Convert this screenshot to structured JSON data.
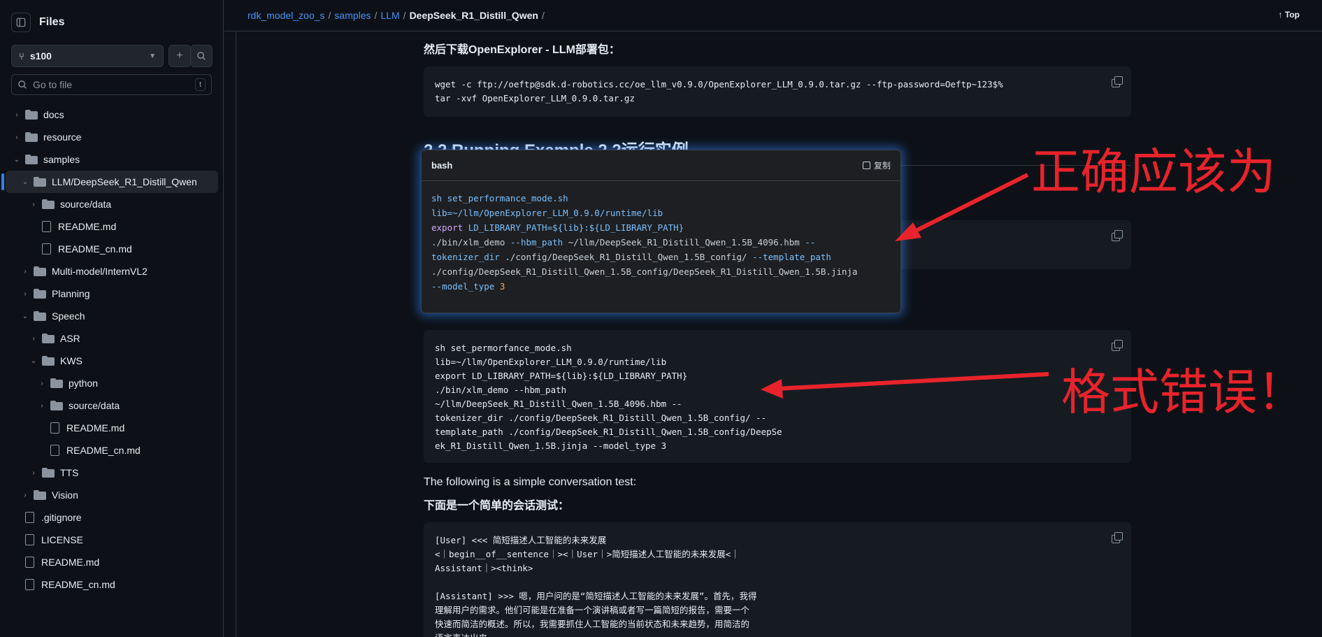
{
  "sidebar": {
    "title": "Files",
    "branch": "s100",
    "goto_placeholder": "Go to file",
    "goto_kbd": "t",
    "tree": [
      {
        "label": "docs",
        "type": "folder",
        "depth": 0,
        "expanded": false
      },
      {
        "label": "resource",
        "type": "folder",
        "depth": 0,
        "expanded": false
      },
      {
        "label": "samples",
        "type": "folder",
        "depth": 0,
        "expanded": true
      },
      {
        "label": "LLM/DeepSeek_R1_Distill_Qwen",
        "type": "folder",
        "depth": 1,
        "expanded": true,
        "selected": true
      },
      {
        "label": "source/data",
        "type": "folder",
        "depth": 2,
        "expanded": false
      },
      {
        "label": "README.md",
        "type": "file",
        "depth": 2
      },
      {
        "label": "README_cn.md",
        "type": "file",
        "depth": 2
      },
      {
        "label": "Multi-model/InternVL2",
        "type": "folder",
        "depth": 1,
        "expanded": false
      },
      {
        "label": "Planning",
        "type": "folder",
        "depth": 1,
        "expanded": false
      },
      {
        "label": "Speech",
        "type": "folder",
        "depth": 1,
        "expanded": true
      },
      {
        "label": "ASR",
        "type": "folder",
        "depth": 2,
        "expanded": false
      },
      {
        "label": "KWS",
        "type": "folder",
        "depth": 2,
        "expanded": true
      },
      {
        "label": "python",
        "type": "folder",
        "depth": 3,
        "expanded": false
      },
      {
        "label": "source/data",
        "type": "folder",
        "depth": 3,
        "expanded": false
      },
      {
        "label": "README.md",
        "type": "file",
        "depth": 3
      },
      {
        "label": "README_cn.md",
        "type": "file",
        "depth": 3
      },
      {
        "label": "TTS",
        "type": "folder",
        "depth": 2,
        "expanded": false
      },
      {
        "label": "Vision",
        "type": "folder",
        "depth": 1,
        "expanded": false
      },
      {
        "label": ".gitignore",
        "type": "file",
        "depth": 0
      },
      {
        "label": "LICENSE",
        "type": "file",
        "depth": 0
      },
      {
        "label": "README.md",
        "type": "file",
        "depth": 0
      },
      {
        "label": "README_cn.md",
        "type": "file",
        "depth": 0
      }
    ]
  },
  "breadcrumb": {
    "items": [
      "rdk_model_zoo_s",
      "samples",
      "LLM"
    ],
    "current": "DeepSeek_R1_Distill_Qwen",
    "sep": "/"
  },
  "topbar": {
    "top_label": "Top"
  },
  "content": {
    "p1": "然后下载OpenExplorer - LLM部署包：",
    "code1": "wget -c ftp://oeftp@sdk.d-robotics.cc/oe_llm_v0.9.0/OpenExplorer_LLM_0.9.0.tar.gz --ftp-password=Oeftp~123$%\ntar -xvf OpenExplorer_LLM_0.9.0.tar.gz",
    "h2": "2.2 Running Example 2.2运行实例",
    "code3": "sh set_permorfance_mode.sh\nlib=~/llm/OpenExplorer_LLM_0.9.0/runtime/lib\nexport LD_LIBRARY_PATH=${lib}:${LD_LIBRARY_PATH}\n./bin/xlm_demo --hbm_path\n~/llm/DeepSeek_R1_Distill_Qwen_1.5B_4096.hbm --\ntokenizer_dir ./config/DeepSeek_R1_Distill_Qwen_1.5B_config/ --\ntemplate_path ./config/DeepSeek_R1_Distill_Qwen_1.5B_config/DeepSe\nek_R1_Distill_Qwen_1.5B.jinja --model_type 3",
    "p2": "The following is a simple conversation test:",
    "p3": "下面是一个简单的会话测试：",
    "code4": "[User] <<< 简短描述人工智能的未来发展\n<｜begin__of__sentence｜><｜User｜>简短描述人工智能的未来发展<｜\nAssistant｜><think>\n\n[Assistant] >>> 嗯，用户问的是“简短描述人工智能的未来发展”。首先，我得\n理解用户的需求。他们可能是在准备一个演讲稿或者写一篇简短的报告，需要一个\n快速而简洁的概述。所以，我需要抓住人工智能的当前状态和未来趋势，用简洁的\n语言表达出来。"
  },
  "popup": {
    "lang": "bash",
    "copy_label": "复制",
    "lines": [
      [
        {
          "t": "sh set_performance_mode.sh",
          "c": "cmd"
        }
      ],
      [
        {
          "t": "lib=~/llm/OpenExplorer_LLM_0.9.0/runtime/lib",
          "c": "cmd"
        }
      ],
      [
        {
          "t": "export ",
          "c": "kw"
        },
        {
          "t": "LD_LIBRARY_PATH=${lib}:${LD_LIBRARY_PATH}",
          "c": "cmd"
        }
      ],
      [
        {
          "t": "./bin/xlm_demo ",
          "c": "plain"
        },
        {
          "t": "--hbm_path ",
          "c": "cmd"
        },
        {
          "t": "~/llm/DeepSeek_R1_Distill_Qwen_1.5B_4096.hbm ",
          "c": "plain"
        },
        {
          "t": "--",
          "c": "cmd"
        }
      ],
      [
        {
          "t": "tokenizer_dir ",
          "c": "cmd"
        },
        {
          "t": "./config/DeepSeek_R1_Distill_Qwen_1.5B_config/ ",
          "c": "plain"
        },
        {
          "t": "--template_path",
          "c": "cmd"
        }
      ],
      [
        {
          "t": "./config/DeepSeek_R1_Distill_Qwen_1.5B_config/DeepSeek_R1_Distill_Qwen_1.5B.jinja",
          "c": "plain"
        }
      ],
      [
        {
          "t": "--model_type ",
          "c": "cmd"
        },
        {
          "t": "3",
          "c": "num"
        }
      ]
    ]
  },
  "annotations": {
    "correct": "正确应该为",
    "wrong": "格式错误！",
    "color": "#e8232b"
  }
}
